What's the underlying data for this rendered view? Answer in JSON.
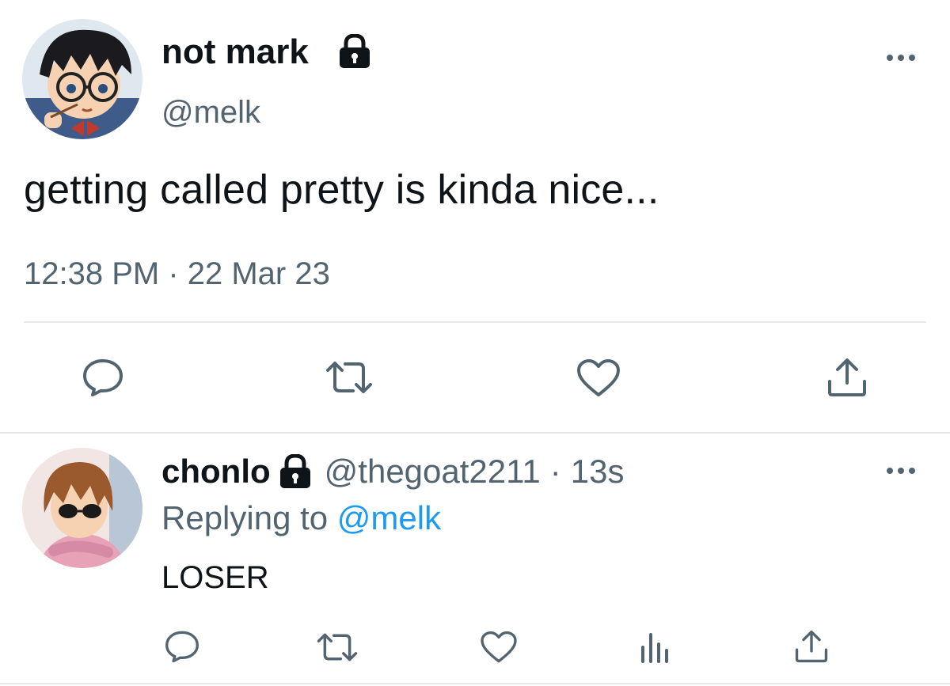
{
  "tweet": {
    "author": {
      "display_name": "not mark",
      "handle": "@melk",
      "protected_icon": "lock-icon",
      "avatar": "avatar-anime-boy-glasses"
    },
    "text": "getting called pretty is kinda nice...",
    "timestamp": "12:38 PM · 22 Mar 23",
    "more_icon": "more-icon",
    "actions": [
      "reply-icon",
      "retweet-icon",
      "like-icon",
      "share-icon"
    ]
  },
  "reply": {
    "author": {
      "display_name": "chonlo",
      "handle": "@thegoat2211",
      "separator": "·",
      "time": "13s",
      "protected_icon": "lock-icon",
      "avatar": "avatar-anime-girl-sunglasses"
    },
    "replying_to_label": "Replying to",
    "replying_to_handle": "@melk",
    "text": "LOSER",
    "more_icon": "more-icon",
    "actions": [
      "reply-icon",
      "retweet-icon",
      "like-icon",
      "analytics-icon",
      "share-icon"
    ]
  },
  "colors": {
    "text_primary": "#0f1419",
    "text_secondary": "#536471",
    "link": "#1d9bf0",
    "divider": "#e6e9eb"
  }
}
